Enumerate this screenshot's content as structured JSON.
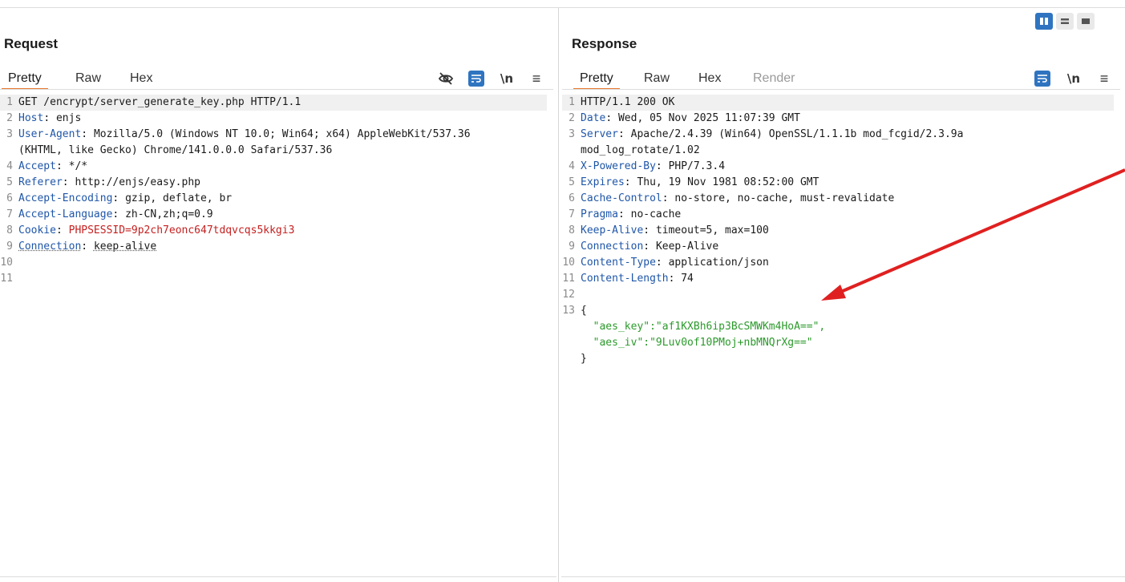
{
  "layout_toggles": [
    "side-by-side",
    "horizontal-split",
    "single-pane"
  ],
  "request": {
    "title": "Request",
    "tabs": [
      "Pretty",
      "Raw",
      "Hex"
    ],
    "icons": [
      "hide-eye-icon",
      "word-wrap-icon",
      "newline-icon",
      "menu-icon"
    ],
    "newline_label": "\\n",
    "lines": [
      {
        "n": "1",
        "key": "",
        "sep": "",
        "val": "GET /encrypt/server_generate_key.php HTTP/1.1"
      },
      {
        "n": "2",
        "key": "Host",
        "sep": ": ",
        "val": "enjs"
      },
      {
        "n": "3",
        "key": "User-Agent",
        "sep": ": ",
        "val": "Mozilla/5.0 (Windows NT 10.0; Win64; x64) AppleWebKit/537.36"
      },
      {
        "n": "",
        "key": "",
        "sep": "",
        "val": "(KHTML, like Gecko) Chrome/141.0.0.0 Safari/537.36"
      },
      {
        "n": "4",
        "key": "Accept",
        "sep": ": ",
        "val": "*/*"
      },
      {
        "n": "5",
        "key": "Referer",
        "sep": ": ",
        "val": "http://enjs/easy.php"
      },
      {
        "n": "6",
        "key": "Accept-Encoding",
        "sep": ": ",
        "val": "gzip, deflate, br"
      },
      {
        "n": "7",
        "key": "Accept-Language",
        "sep": ": ",
        "val": "zh-CN,zh;q=0.9"
      },
      {
        "n": "8",
        "key": "Cookie",
        "sep": ": ",
        "val": "",
        "cookie_name": "PHPSESSID",
        "cookie_value": "9p2ch7eonc647tdqvcqs5kkgi3"
      },
      {
        "n": "9",
        "key": "Connection",
        "sep": ": ",
        "val": "keep-alive"
      },
      {
        "n": "10",
        "key": "",
        "sep": "",
        "val": ""
      },
      {
        "n": "11",
        "key": "",
        "sep": "",
        "val": ""
      }
    ]
  },
  "response": {
    "title": "Response",
    "tabs": [
      "Pretty",
      "Raw",
      "Hex",
      "Render"
    ],
    "icons": [
      "word-wrap-icon",
      "newline-icon",
      "menu-icon"
    ],
    "newline_label": "\\n",
    "lines": [
      {
        "n": "1",
        "key": "",
        "sep": "",
        "val": "HTTP/1.1 200 OK"
      },
      {
        "n": "2",
        "key": "Date",
        "sep": ": ",
        "val": "Wed, 05 Nov 2025 11:07:39 GMT"
      },
      {
        "n": "3",
        "key": "Server",
        "sep": ": ",
        "val": "Apache/2.4.39 (Win64) OpenSSL/1.1.1b mod_fcgid/2.3.9a"
      },
      {
        "n": "",
        "key": "",
        "sep": "",
        "val": "mod_log_rotate/1.02"
      },
      {
        "n": "4",
        "key": "X-Powered-By",
        "sep": ": ",
        "val": "PHP/7.3.4"
      },
      {
        "n": "5",
        "key": "Expires",
        "sep": ": ",
        "val": "Thu, 19 Nov 1981 08:52:00 GMT"
      },
      {
        "n": "6",
        "key": "Cache-Control",
        "sep": ": ",
        "val": "no-store, no-cache, must-revalidate"
      },
      {
        "n": "7",
        "key": "Pragma",
        "sep": ": ",
        "val": "no-cache"
      },
      {
        "n": "8",
        "key": "Keep-Alive",
        "sep": ": ",
        "val": "timeout=5, max=100"
      },
      {
        "n": "9",
        "key": "Connection",
        "sep": ": ",
        "val": "Keep-Alive"
      },
      {
        "n": "10",
        "key": "Content-Type",
        "sep": ": ",
        "val": "application/json"
      },
      {
        "n": "11",
        "key": "Content-Length",
        "sep": ": ",
        "val": "74"
      },
      {
        "n": "12",
        "key": "",
        "sep": "",
        "val": ""
      },
      {
        "n": "13",
        "key": "",
        "sep": "",
        "val": "{"
      },
      {
        "n": "",
        "key": "",
        "sep": "",
        "val": "",
        "json": "  \"aes_key\":\"af1KXBh6ip3BcSMWKm4HoA==\","
      },
      {
        "n": "",
        "key": "",
        "sep": "",
        "val": "",
        "json": "  \"aes_iv\":\"9Luv0of10PMoj+nbMNQrXg==\""
      },
      {
        "n": "",
        "key": "",
        "sep": "",
        "val": "}"
      }
    ]
  },
  "annotation": {
    "color": "#e02020"
  }
}
